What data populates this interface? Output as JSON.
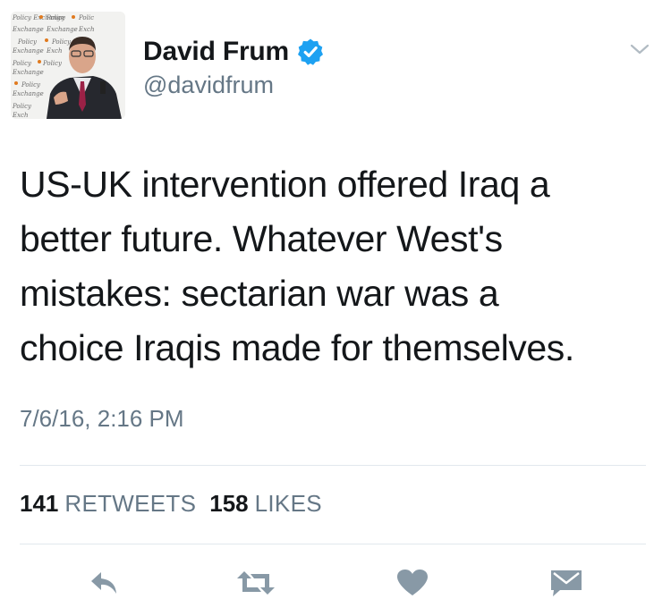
{
  "author": {
    "display_name": "David Frum",
    "handle": "@davidfrum",
    "verified": true,
    "avatar_backdrop_text": "Policy Exchange"
  },
  "tweet": {
    "text": "US-UK intervention offered Iraq a\nbetter future. Whatever West's\nmistakes: sectarian war was a\nchoice Iraqis made for themselves.",
    "timestamp": "7/6/16, 2:16 PM"
  },
  "stats": {
    "retweets_count": "141",
    "retweets_label": "RETWEETS",
    "likes_count": "158",
    "likes_label": "LIKES"
  },
  "actions": [
    {
      "name": "reply",
      "icon": "reply-icon"
    },
    {
      "name": "retweet",
      "icon": "retweet-icon"
    },
    {
      "name": "like",
      "icon": "heart-icon"
    },
    {
      "name": "direct-message",
      "icon": "envelope-icon"
    }
  ],
  "colors": {
    "text": "#14171a",
    "secondary": "#657786",
    "icon": "#8899a6",
    "verified": "#1da1f2",
    "divider": "#e1e8ed"
  }
}
